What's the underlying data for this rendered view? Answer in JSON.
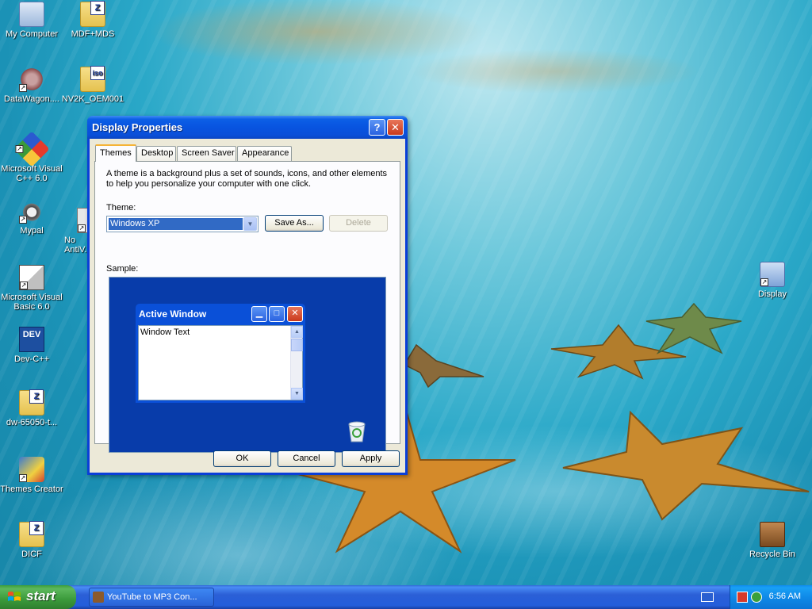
{
  "desktop": {
    "icons": [
      {
        "label": "My Computer"
      },
      {
        "label": "MDF+MDS",
        "badge": "Z"
      },
      {
        "label": "DataWagon...."
      },
      {
        "label": "NV2K_OEM001",
        "badge": "iso"
      },
      {
        "label": "Microsoft Visual C++ 6.0"
      },
      {
        "label": "Mypal"
      },
      {
        "label": "Microsoft Visual Basic 6.0"
      },
      {
        "label": "Dev-C++",
        "badge": "DEV"
      },
      {
        "label": "dw-65050-t...",
        "badge": "Z"
      },
      {
        "label": "Themes Creator"
      },
      {
        "label": "DICF",
        "badge": "Z"
      },
      {
        "label": "Display"
      },
      {
        "label": "Recycle Bin"
      },
      {
        "label": "No AntiV..."
      }
    ]
  },
  "dialog": {
    "title": "Display Properties",
    "help_label": "?",
    "close_label": "✕",
    "tabs": [
      "Themes",
      "Desktop",
      "Screen Saver",
      "Appearance"
    ],
    "description": "A theme is a background plus a set of sounds, icons, and other elements to help you personalize your computer with one click.",
    "theme_label": "Theme:",
    "theme_value": "Windows XP",
    "save_as_label": "Save As...",
    "delete_label": "Delete",
    "sample_label": "Sample:",
    "sample_window": {
      "title": "Active Window",
      "text": "Window Text"
    },
    "ok_label": "OK",
    "cancel_label": "Cancel",
    "apply_label": "Apply"
  },
  "taskbar": {
    "start_label": "start",
    "task_label": "YouTube to MP3 Con...",
    "clock": "6:56 AM"
  }
}
